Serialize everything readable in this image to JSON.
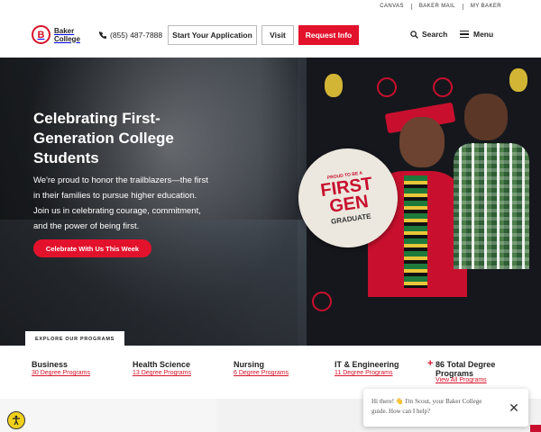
{
  "utility_links": [
    "CANVAS",
    "BAKER MAIL",
    "MY BAKER"
  ],
  "logo": {
    "mark": "B",
    "text": "Baker College"
  },
  "header": {
    "phone": "(855) 487-7888",
    "apply": "Start Your Application",
    "visit": "Visit",
    "request": "Request Info",
    "search": "Search",
    "menu": "Menu"
  },
  "hero": {
    "title": "Celebrating First-Generation College Students",
    "body": "We're proud to honor the trailblazers—the first in their families to pursue higher education. Join us in celebrating courage, commitment, and the power of being first.",
    "cta": "Celebrate With Us This Week",
    "sign": {
      "top": "PROUD TO BE A",
      "big1": "FIRST",
      "big2": "GEN",
      "bottom": "GRADUATE"
    }
  },
  "programs": {
    "tab": "EXPLORE OUR PROGRAMS",
    "items": [
      {
        "name": "Business",
        "link": "30 Degree Programs"
      },
      {
        "name": "Health Science",
        "link": "13 Degree Programs"
      },
      {
        "name": "Nursing",
        "link": "6 Degree Programs"
      },
      {
        "name": "IT & Engineering",
        "link": "11 Degree Programs"
      }
    ],
    "total": {
      "name": "86 Total Degree Programs",
      "link": "View All Programs"
    }
  },
  "chat": {
    "text": "Hi there! 👋 I'm Scout, your Baker College guide. How can I help?",
    "close": "✕"
  },
  "colors": {
    "brand_red": "#e3122c",
    "text": "#222222"
  }
}
